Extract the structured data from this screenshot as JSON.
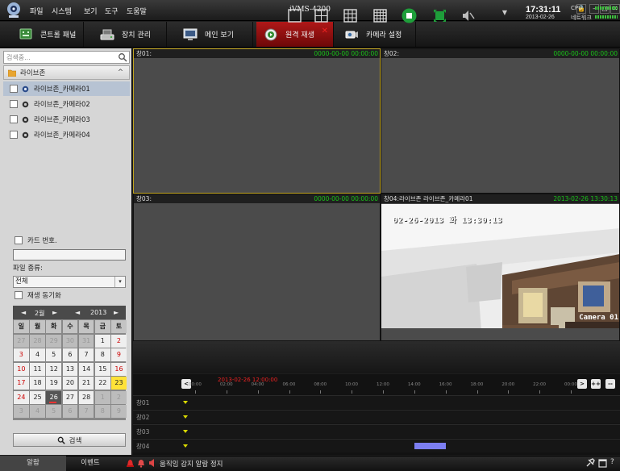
{
  "app": {
    "title": "iVMS-4200"
  },
  "menu": [
    "파일",
    "시스템",
    "보기",
    "도구",
    "도움말"
  ],
  "window_buttons": {
    "lock": "🔒",
    "minimize": "–",
    "restore": "□",
    "close": "✕"
  },
  "tabs": [
    {
      "label": "콘트롤 패널",
      "icon": "control-panel-icon",
      "active": false
    },
    {
      "label": "장치 관리",
      "icon": "device-management-icon",
      "active": false
    },
    {
      "label": "메인 보기",
      "icon": "main-view-icon",
      "active": false
    },
    {
      "label": "원격 재생",
      "icon": "remote-playback-icon",
      "active": true
    },
    {
      "label": "카메라 설정",
      "icon": "camera-settings-icon",
      "active": false
    }
  ],
  "tab_close": "✕",
  "tab_expand": "▼",
  "clock": {
    "time": "17:31:11",
    "date": "2013-02-26"
  },
  "sysmon": {
    "cpu_label": "CPU",
    "network_label": "네트워크"
  },
  "sidebar": {
    "search_placeholder": "검색중...",
    "group": {
      "name": "라이브존",
      "collapse_arrow": "^"
    },
    "cameras": [
      {
        "name": "라이브존_카메라01",
        "selected": true
      },
      {
        "name": "라이브존_카메라02",
        "selected": false
      },
      {
        "name": "라이브존_카메라03",
        "selected": false
      },
      {
        "name": "라이브존_카메라04",
        "selected": false
      }
    ],
    "card_number_label": "카드 번호.",
    "file_type_label": "파일 종류:",
    "file_type_value": "전체",
    "sync_label": "재생 동기화",
    "search_button": "검색"
  },
  "calendar": {
    "month_prev": "◄",
    "month_next": "►",
    "year_prev": "◄",
    "year_next": "►",
    "month": "2월",
    "year": "2013",
    "weekdays": [
      "일",
      "월",
      "화",
      "수",
      "목",
      "금",
      "토"
    ],
    "weeks": [
      [
        "27",
        "28",
        "29",
        "30",
        "31",
        "1",
        "2"
      ],
      [
        "3",
        "4",
        "5",
        "6",
        "7",
        "8",
        "9"
      ],
      [
        "10",
        "11",
        "12",
        "13",
        "14",
        "15",
        "16"
      ],
      [
        "17",
        "18",
        "19",
        "20",
        "21",
        "22",
        "23"
      ],
      [
        "24",
        "25",
        "26",
        "27",
        "28",
        "1",
        "2"
      ],
      [
        "3",
        "4",
        "5",
        "6",
        "7",
        "8",
        "9"
      ]
    ],
    "selected_day": "26",
    "highlighted_day": "23",
    "days_with_recordings": [
      "26"
    ]
  },
  "panes": [
    {
      "title": "창01:",
      "time": "0000-00-00 00:00:00",
      "selected": true
    },
    {
      "title": "창02:",
      "time": "0000-00-00 00:00:00",
      "selected": false
    },
    {
      "title": "창03:",
      "time": "0000-00-00 00:00:00",
      "selected": false
    },
    {
      "title": "창04:라이브존 라이브존_카메라01",
      "time": "2013-02-26 13:30:13",
      "selected": false
    }
  ],
  "video_osd": {
    "timestamp": "02-26-2013 화 13:30:13",
    "camera_label": "Camera 01"
  },
  "layout_controls": [
    "layout-1x1-icon",
    "layout-2x2-icon",
    "layout-3x3-icon",
    "layout-4x4-icon",
    "stop-all-icon",
    "fullscreen-icon",
    "mute-icon"
  ],
  "timeline": {
    "current": "2013-02-26 12:00:00",
    "ticks": [
      "00:00",
      "02:00",
      "04:00",
      "06:00",
      "08:00",
      "10:00",
      "12:00",
      "14:00",
      "16:00",
      "18:00",
      "20:00",
      "22:00",
      "00:00"
    ],
    "nav_prev": "<",
    "nav_next": ">",
    "zoom_in": "++",
    "zoom_out": "--",
    "rows": [
      "창01",
      "창02",
      "창03",
      "창04"
    ],
    "recording": {
      "window": "창04",
      "start": "14:00",
      "end": "16:00"
    }
  },
  "status": {
    "alarm_tab": "알람",
    "event_tab": "이벤트",
    "message": "움직임 감지 알람 정지"
  },
  "colors": {
    "active_tab": "#b01818",
    "osd_time_green": "#19c319",
    "selection_yellow": "#c2a621",
    "record_bar": "#7c7ef2",
    "today_yellow": "#ffe238"
  }
}
